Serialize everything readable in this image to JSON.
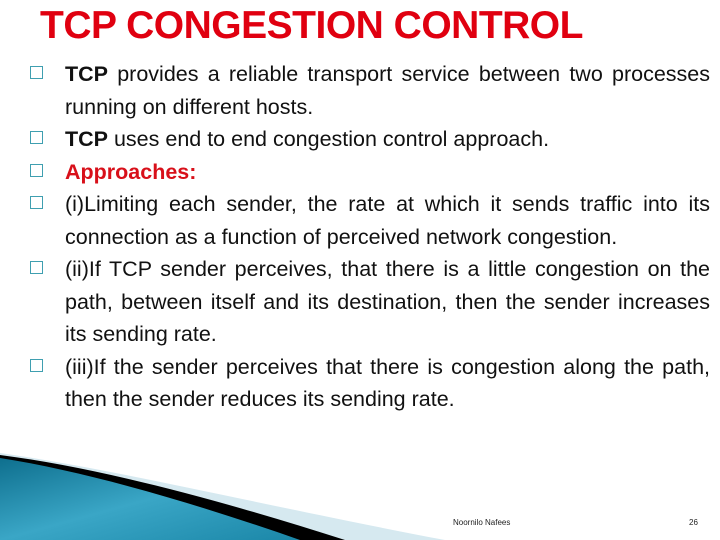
{
  "slide": {
    "title": "TCP CONGESTION CONTROL",
    "bullets": [
      {
        "lead": "TCP",
        "text": " provides a reliable transport service between two processes running on different hosts."
      },
      {
        "lead": "TCP",
        "text": " uses end to end congestion control approach."
      },
      {
        "lead": "",
        "heading": "Approaches:",
        "text": ""
      },
      {
        "lead": "",
        "text": "(i)Limiting each sender, the rate at which it sends traffic into its connection as a function of perceived network congestion."
      },
      {
        "lead": "",
        "text": "(ii)If TCP sender perceives, that there is a little congestion on the path, between itself and its destination, then the sender increases its sending rate."
      },
      {
        "lead": "",
        "text": "(iii)If the sender perceives that there is congestion along the path, then the sender reduces its sending rate."
      }
    ],
    "bullet_icon": "square-bullet-icon",
    "colors": {
      "title": "#e00010",
      "heading": "#d8101a",
      "bullet": "#3f9fb0",
      "wave": "#1f8fae"
    }
  },
  "footer": {
    "author": "Noornilo Nafees",
    "page_number": "26"
  }
}
